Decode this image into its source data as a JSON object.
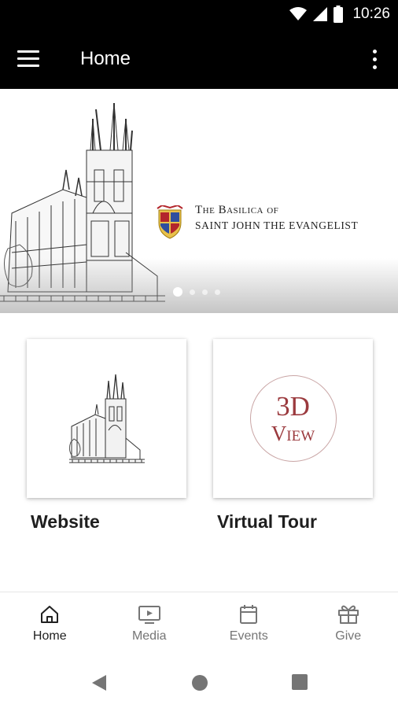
{
  "status_bar": {
    "time": "10:26"
  },
  "app_bar": {
    "title": "Home"
  },
  "banner": {
    "title_line1": "The Basilica of",
    "title_line2": "SAINT JOHN THE EVANGELIST",
    "slide_count": 4,
    "active_slide": 1
  },
  "cards": [
    {
      "label": "Website",
      "icon": "church-sketch-image"
    },
    {
      "label": "Virtual Tour",
      "icon": "3d-view-logo",
      "logo_line1": "3D",
      "logo_line2": "View"
    }
  ],
  "bottom_nav": {
    "items": [
      {
        "label": "Home",
        "icon": "home-icon",
        "active": true
      },
      {
        "label": "Media",
        "icon": "tv-play-icon",
        "active": false
      },
      {
        "label": "Events",
        "icon": "calendar-icon",
        "active": false
      },
      {
        "label": "Give",
        "icon": "gift-icon",
        "active": false
      }
    ]
  },
  "colors": {
    "app_bar": "#000000",
    "accent_red": "#9b3a3e",
    "nav_inactive": "#757575",
    "nav_active": "#212121"
  }
}
